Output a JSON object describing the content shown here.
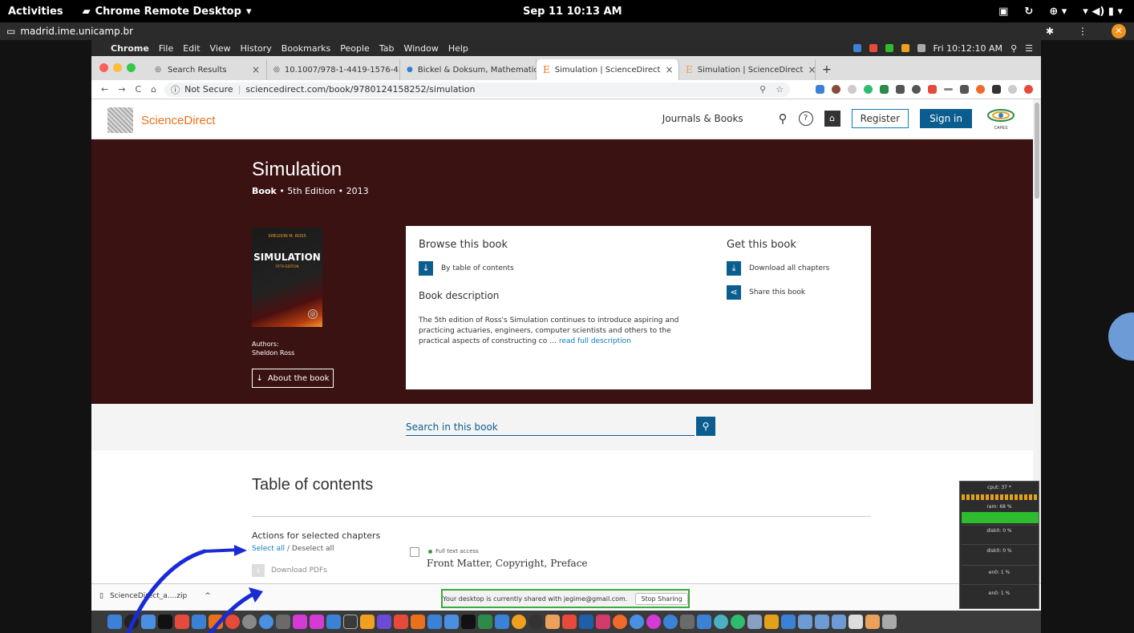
{
  "gnome": {
    "activities": "Activities",
    "app_name": "Chrome Remote Desktop",
    "clock": "Sep 11  10:13 AM"
  },
  "remote": {
    "host": "madrid.ime.unicamp.br"
  },
  "mac_menubar": {
    "app": "Chrome",
    "menus": [
      "File",
      "Edit",
      "View",
      "History",
      "Bookmarks",
      "People",
      "Tab",
      "Window",
      "Help"
    ],
    "clock": "Fri 10:12:10 AM"
  },
  "tabs": [
    {
      "label": "Search Results",
      "active": false
    },
    {
      "label": "10.1007/978-1-4419-1576-4.p",
      "active": false
    },
    {
      "label": "Bickel & Doksum, Mathematic",
      "active": false
    },
    {
      "label": "Simulation | ScienceDirect",
      "active": true
    },
    {
      "label": "Simulation | ScienceDirect",
      "active": false
    }
  ],
  "omnibar": {
    "security": "Not Secure",
    "url": "sciencedirect.com/book/9780124158252/simulation"
  },
  "header": {
    "brand": "ScienceDirect",
    "journals": "Journals & Books",
    "register": "Register",
    "signin": "Sign in",
    "capes": "CAPES"
  },
  "book": {
    "title": "Simulation",
    "type": "Book",
    "meta": " • 5th Edition • 2013",
    "cover_author": "SHELDON M. ROSS",
    "cover_title": "SIMULATION",
    "cover_edition": "FIFTH EDITION",
    "authors_label": "Authors:",
    "author": "Sheldon Ross",
    "about_btn": "About the book"
  },
  "browse": {
    "heading": "Browse this book",
    "toc_link": "By table of contents",
    "desc_heading": "Book description",
    "desc_text": "The 5th edition of Ross's Simulation continues to introduce aspiring and practicing actuaries, engineers, computer scientists and others to the practical aspects of constructing co … ",
    "read_more": "read full description",
    "get_heading": "Get this book",
    "download_all": "Download all chapters",
    "share": "Share this book"
  },
  "search": {
    "placeholder": "Search in this book"
  },
  "toc": {
    "title": "Table of contents",
    "actions_label": "Actions for selected chapters",
    "select_all": "Select all",
    "slash": " / ",
    "deselect_all": "Deselect all",
    "download_pdfs": "Download PDFs",
    "access": "Full text access",
    "first_chapter": "Front Matter, Copyright, Preface"
  },
  "shelf": {
    "file": "ScienceDirect_a....zip",
    "share_notice": "Your desktop is currently shared with jegime@gmail.com.",
    "stop_sharing": "Stop Sharing"
  },
  "sysmon": {
    "cpu": "cput: 37 *",
    "ram": "ram: 68 %",
    "disk1": "disk0: 0 %",
    "disk2": "disk0: 0 %",
    "net1": "en0: 1 %",
    "net2": "en0: 1 %"
  }
}
